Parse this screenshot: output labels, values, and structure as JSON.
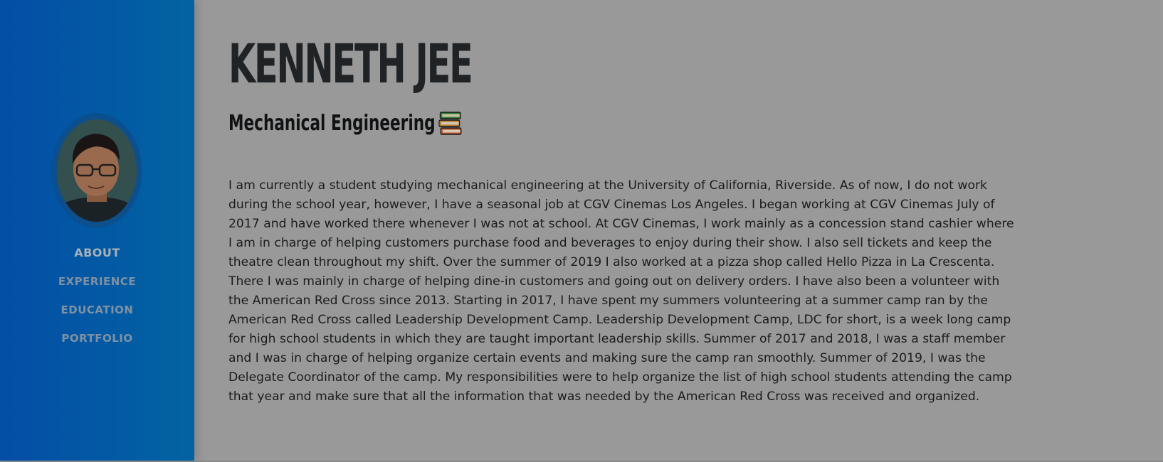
{
  "sidebar": {
    "avatar_alt": "Kenneth Jee profile photo",
    "nav": [
      {
        "label": "ABOUT",
        "active": true
      },
      {
        "label": "EXPERIENCE",
        "active": false
      },
      {
        "label": "EDUCATION",
        "active": false
      },
      {
        "label": "PORTFOLIO",
        "active": false
      }
    ]
  },
  "main": {
    "name": "KENNETH JEE",
    "subtitle": "Mechanical Engineering",
    "subtitle_icon": "books-icon",
    "bio": "I am currently a student studying mechanical engineering at the University of California, Riverside. As of now, I do not work during the school year, however, I have a seasonal job at CGV Cinemas Los Angeles. I began working at CGV Cinemas July of 2017 and have worked there whenever I was not at school. At CGV Cinemas, I work mainly as a concession stand cashier where I am in charge of helping customers purchase food and beverages to enjoy during their show. I also sell tickets and keep the theatre clean throughout my shift. Over the summer of 2019 I also worked at a pizza shop called Hello Pizza in La Crescenta. There I was mainly in charge of helping dine-in customers and going out on delivery orders. I have also been a volunteer with the American Red Cross since 2013. Starting in 2017, I have spent my summers volunteering at a summer camp ran by the American Red Cross called Leadership Development Camp. Leadership Development Camp, LDC for short, is a week long camp for high school students in which they are taught important leadership skills. Summer of 2017 and 2018, I was a staff member and I was in charge of helping organize certain events and making sure the camp ran smoothly. Summer of 2019, I was the Delegate Coordinator of the camp. My responsibilities were to help organize the list of high school students attending the camp that year and make sure that all the information that was needed by the American Red Cross was received and organized."
  },
  "colors": {
    "sidebar_start": "#034ea6",
    "sidebar_end": "#0363a2",
    "overlay_bg": "#999999",
    "heading": "#202326"
  }
}
